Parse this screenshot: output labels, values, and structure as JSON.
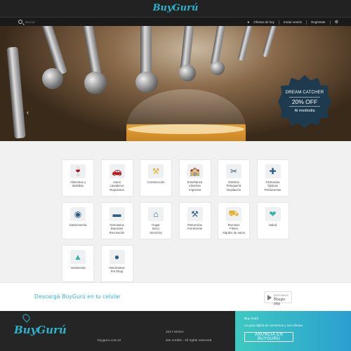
{
  "header": {
    "logo": "BuyGurú"
  },
  "nav": {
    "search_placeholder": "Buscar",
    "offers": "Ofertas de hoy",
    "login": "Iniciar sesión",
    "register": "Registrate"
  },
  "hero": {
    "badge_title": "DREAM CATCHER",
    "badge_offer": "20% OFF",
    "badge_sub": "Al mediodía"
  },
  "categories": [
    {
      "label": "Alimentos y\nBebidas",
      "icon": "food-drink-icon",
      "color": "#2c5b84"
    },
    {
      "label": "Autos\nLavaderos\nRepuestos",
      "icon": "car-icon",
      "color": "#2c5b84"
    },
    {
      "label": "Construcción",
      "icon": "construction-icon",
      "color": "#e2b233"
    },
    {
      "label": "Enseñanza\nLibrerías\nImprenta",
      "icon": "school-icon",
      "color": "#3b84b8"
    },
    {
      "label": "Estética\nPeluquería\nDepilación",
      "icon": "scissors-icon",
      "color": "#2c5b84"
    },
    {
      "label": "Farmacias\nÓpticas\nPerfumerías",
      "icon": "pharmacy-cross-icon",
      "color": "#2c5b84"
    },
    {
      "label": "Gastronomía",
      "icon": "dish-icon",
      "color": "#2c5b84"
    },
    {
      "label": "Gimnasios\nDeportes\nRecreación",
      "icon": "dumbbell-icon",
      "color": "#2c5b84"
    },
    {
      "label": "Hogar\nDeco\nServicios",
      "icon": "house-icon",
      "color": "#2c5b84"
    },
    {
      "label": "Pinturerías\nFerreterías",
      "icon": "tools-icon",
      "color": "#2c5b84"
    },
    {
      "label": "Remises\nFletes\nAlquiler de autos",
      "icon": "truck-icon",
      "color": "#e2b233"
    },
    {
      "label": "Salud",
      "icon": "heart-health-icon",
      "color": "#3bb3a8"
    },
    {
      "label": "Vestimenta",
      "icon": "tshirt-icon",
      "color": "#3bb3a8"
    },
    {
      "label": "Veterinarias\nPet Shop",
      "icon": "paw-icon",
      "color": "#2c5b84"
    }
  ],
  "download": {
    "text": "Descargá BuyGurú en tu celular",
    "store_top": "DISPONIBLE EN",
    "store_name": "Google play"
  },
  "footer": {
    "logo": "BuyGurú",
    "url": "buyguru.com.ar",
    "year": "2017 MVDA",
    "credits": "site credits - All rights reserved"
  },
  "cta": {
    "brand": "Buy Gurú",
    "tagline": "La guía digital de comercios y sus ofertas.",
    "button": "ANUNCIÁ EN BUYGURÚ"
  }
}
